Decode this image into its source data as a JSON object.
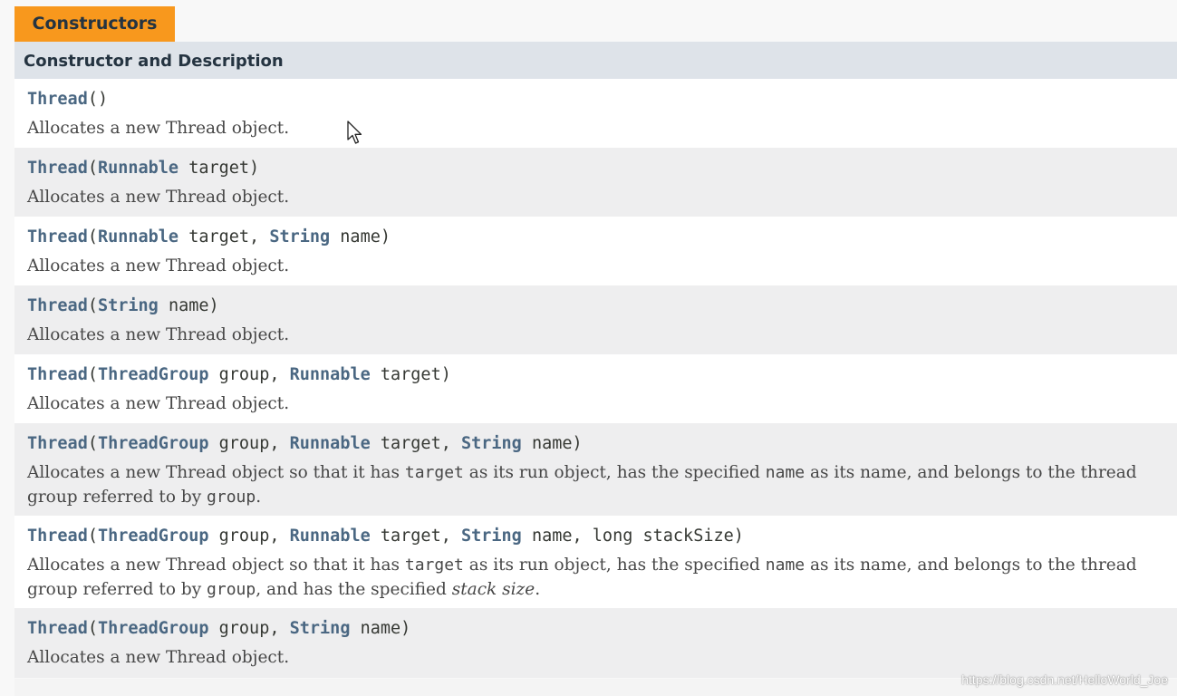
{
  "section_tab": "Constructors",
  "table_header": "Constructor and Description",
  "constructors": [
    {
      "name": "Thread",
      "params": [],
      "description_parts": [
        {
          "t": "text",
          "v": "Allocates a new Thread object."
        }
      ]
    },
    {
      "name": "Thread",
      "params": [
        {
          "type": "Runnable",
          "name": "target"
        }
      ],
      "description_parts": [
        {
          "t": "text",
          "v": "Allocates a new Thread object."
        }
      ]
    },
    {
      "name": "Thread",
      "params": [
        {
          "type": "Runnable",
          "name": "target"
        },
        {
          "type": "String",
          "name": "name"
        }
      ],
      "description_parts": [
        {
          "t": "text",
          "v": "Allocates a new Thread object."
        }
      ]
    },
    {
      "name": "Thread",
      "params": [
        {
          "type": "String",
          "name": "name"
        }
      ],
      "description_parts": [
        {
          "t": "text",
          "v": "Allocates a new Thread object."
        }
      ]
    },
    {
      "name": "Thread",
      "params": [
        {
          "type": "ThreadGroup",
          "name": "group"
        },
        {
          "type": "Runnable",
          "name": "target"
        }
      ],
      "description_parts": [
        {
          "t": "text",
          "v": "Allocates a new Thread object."
        }
      ]
    },
    {
      "name": "Thread",
      "params": [
        {
          "type": "ThreadGroup",
          "name": "group"
        },
        {
          "type": "Runnable",
          "name": "target"
        },
        {
          "type": "String",
          "name": "name"
        }
      ],
      "description_parts": [
        {
          "t": "text",
          "v": "Allocates a new Thread object so that it has "
        },
        {
          "t": "code",
          "v": "target"
        },
        {
          "t": "text",
          "v": " as its run object, has the specified "
        },
        {
          "t": "code",
          "v": "name"
        },
        {
          "t": "text",
          "v": " as its name, and belongs to the thread group referred to by "
        },
        {
          "t": "code",
          "v": "group"
        },
        {
          "t": "text",
          "v": "."
        }
      ]
    },
    {
      "name": "Thread",
      "params": [
        {
          "type": "ThreadGroup",
          "name": "group"
        },
        {
          "type": "Runnable",
          "name": "target"
        },
        {
          "type": "String",
          "name": "name"
        },
        {
          "type": "long",
          "name": "stackSize",
          "plain": true
        }
      ],
      "description_parts": [
        {
          "t": "text",
          "v": "Allocates a new Thread object so that it has "
        },
        {
          "t": "code",
          "v": "target"
        },
        {
          "t": "text",
          "v": " as its run object, has the specified "
        },
        {
          "t": "code",
          "v": "name"
        },
        {
          "t": "text",
          "v": " as its name, and belongs to the thread group referred to by "
        },
        {
          "t": "code",
          "v": "group"
        },
        {
          "t": "text",
          "v": ", and has the specified "
        },
        {
          "t": "em",
          "v": "stack size"
        },
        {
          "t": "text",
          "v": "."
        }
      ]
    },
    {
      "name": "Thread",
      "params": [
        {
          "type": "ThreadGroup",
          "name": "group"
        },
        {
          "type": "String",
          "name": "name"
        }
      ],
      "description_parts": [
        {
          "t": "text",
          "v": "Allocates a new Thread object."
        }
      ]
    }
  ],
  "watermark": "https://blog.csdn.net/HelloWorld_Joe",
  "colors": {
    "tab_bg": "#f8981d",
    "header_bg": "#dee3e9",
    "link": "#4a6782",
    "row_alt": "#eeeeef"
  }
}
